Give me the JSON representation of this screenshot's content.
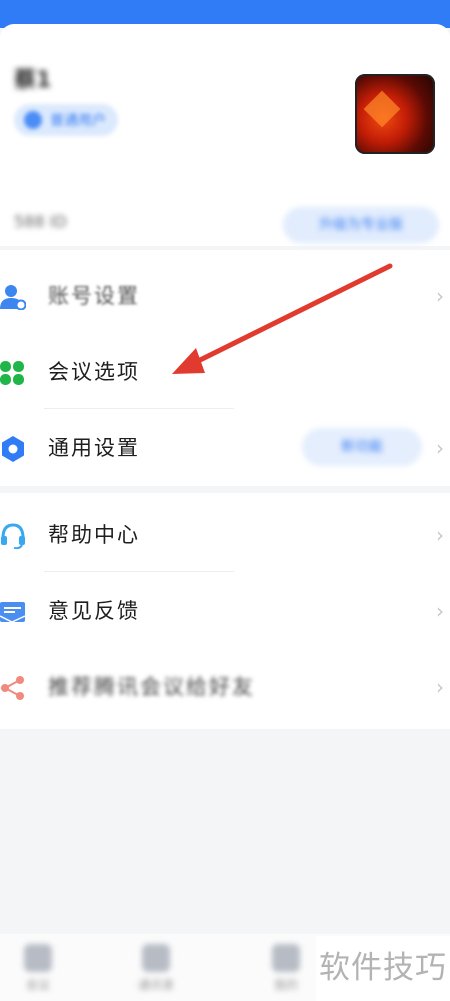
{
  "profile": {
    "name": "蔡1",
    "badge": "普通用户",
    "account_id": "588 ID",
    "action_label": "升级为专业版"
  },
  "menu": {
    "items": [
      {
        "label": "账号设置",
        "icon": "account-settings-icon",
        "color": "#3d86f0"
      },
      {
        "label": "会议选项",
        "icon": "four-leaf-clover-icon",
        "color": "#1fb548"
      },
      {
        "label": "通用设置",
        "icon": "hexagon-settings-icon",
        "color": "#2f7cf6",
        "badge": "新功能"
      },
      {
        "label": "帮助中心",
        "icon": "headset-icon",
        "color": "#38a8f0"
      },
      {
        "label": "意见反馈",
        "icon": "feedback-mail-icon",
        "color": "#4a8ef2"
      },
      {
        "label": "推荐腾讯会议给好友",
        "icon": "share-icon",
        "color": "#f08a7d"
      }
    ]
  },
  "tabs": [
    {
      "label": "会议"
    },
    {
      "label": "通讯录"
    },
    {
      "label": "我的"
    }
  ],
  "annotation": {
    "arrow_color": "#e13b2f"
  },
  "watermark": "软件技巧",
  "colors": {
    "accent": "#2f7cf6",
    "background": "#f4f5f7"
  }
}
